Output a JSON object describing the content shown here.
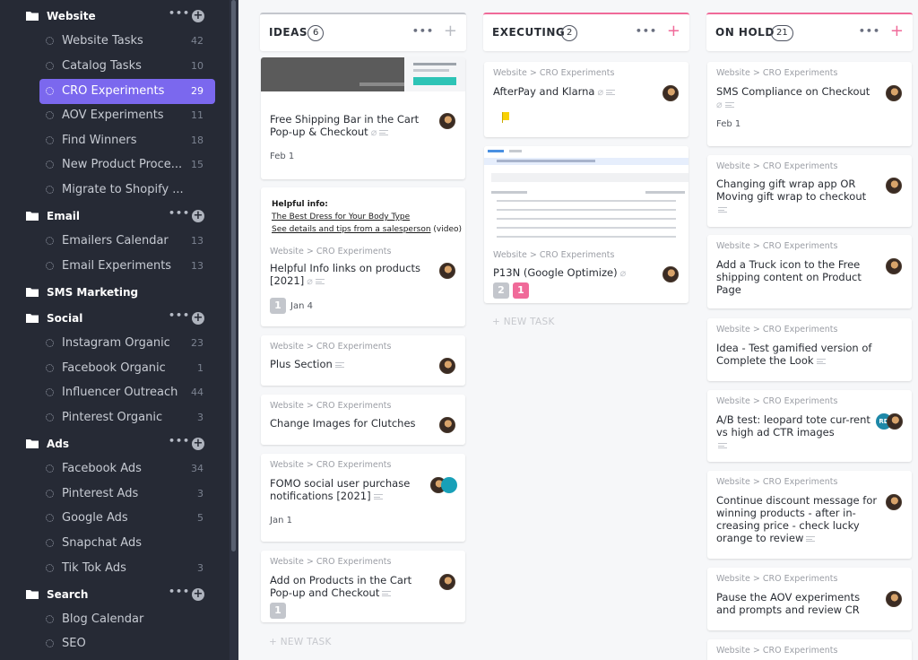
{
  "sidebar": {
    "folders": [
      {
        "label": "Website",
        "has_actions": true
      },
      {
        "label": "Email",
        "has_actions": true
      },
      {
        "label": "SMS Marketing",
        "has_actions": false
      },
      {
        "label": "Social",
        "has_actions": true
      },
      {
        "label": "Ads",
        "has_actions": true
      },
      {
        "label": "Search",
        "has_actions": true
      }
    ],
    "folder_dots": "•••",
    "folder_plus": "+",
    "lists": [
      {
        "label": "Website Tasks",
        "count": "42"
      },
      {
        "label": "Catalog Tasks",
        "count": "10"
      },
      {
        "label": "CRO Experiments",
        "count": "29",
        "active": true
      },
      {
        "label": "AOV Experiments",
        "count": "11"
      },
      {
        "label": "Find Winners",
        "count": "18"
      },
      {
        "label": "New Product Proce...",
        "count": "15"
      },
      {
        "label": "Migrate to Shopify ...",
        "count": ""
      },
      {
        "label": "Emailers Calendar",
        "count": "13"
      },
      {
        "label": "Email Experiments",
        "count": "13"
      },
      {
        "label": "Instagram Organic",
        "count": "23"
      },
      {
        "label": "Facebook Organic",
        "count": "1"
      },
      {
        "label": "Influencer Outreach",
        "count": "44"
      },
      {
        "label": "Pinterest Organic",
        "count": "3"
      },
      {
        "label": "Facebook Ads",
        "count": "34"
      },
      {
        "label": "Pinterest Ads",
        "count": "3"
      },
      {
        "label": "Google Ads",
        "count": "5"
      },
      {
        "label": "Snapchat Ads",
        "count": ""
      },
      {
        "label": "Tik Tok Ads",
        "count": "3"
      },
      {
        "label": "Blog Calendar",
        "count": ""
      },
      {
        "label": "SEO",
        "count": ""
      }
    ]
  },
  "colors": {
    "accent": "#7b68ee",
    "pink": "#f06a99",
    "sidebar_bg": "#262a35",
    "flag": "#f8d104"
  },
  "board": {
    "columns": [
      {
        "title": "IDEAS",
        "count": "6",
        "dots": "•••",
        "plus": "+"
      },
      {
        "title": "EXECUTING",
        "count": "2",
        "dots": "•••",
        "plus": "+"
      },
      {
        "title": "ON HOLD",
        "count": "21",
        "dots": "•••",
        "plus": "+"
      }
    ],
    "breadcrumb": "Website > CRO Experiments",
    "new_task": "+ NEW TASK",
    "ideas": [
      {
        "title": "Free Shipping Bar in the Cart Pop-up & Checkout",
        "date": "Feb 1"
      },
      {
        "title": "Helpful Info links on products [2021]",
        "date": "Jan 4",
        "badge": "1"
      },
      {
        "title": "Plus Section"
      },
      {
        "title": "Change Images for Clutches"
      },
      {
        "title": "FOMO social user purchase notifications [2021]",
        "date": "Jan 1"
      },
      {
        "title": "Add on Products in the Cart Pop-up and Checkout",
        "badge": "1"
      }
    ],
    "helpful_preview": {
      "heading": "Helpful info:",
      "line1": "The Best Dress for Your Body Type",
      "line2": "See details and tips from a salesperson",
      "line2_suffix": " (video)"
    },
    "executing": [
      {
        "title": "AfterPay and Klarna"
      },
      {
        "title": "P13N (Google Optimize)",
        "badge_grey": "2",
        "badge_pink": "1"
      }
    ],
    "on_hold": [
      {
        "title": "SMS Compliance on Checkout",
        "date": "Feb 1"
      },
      {
        "title": "Changing gift wrap app OR Moving gift wrap to checkout"
      },
      {
        "title": "Add a Truck icon to the Free shipping content on Product Page"
      },
      {
        "title": "Idea - Test gamified version of Complete the Look"
      },
      {
        "title": "A/B test: leopard tote cur-rent vs high ad CTR images",
        "avatar_initials": "RD"
      },
      {
        "title": "Continue discount message for winning products - after in-creasing price - check lucky orange to review"
      },
      {
        "title": "Pause the AOV experiments and prompts and review CR"
      },
      {
        "title": ""
      }
    ]
  }
}
